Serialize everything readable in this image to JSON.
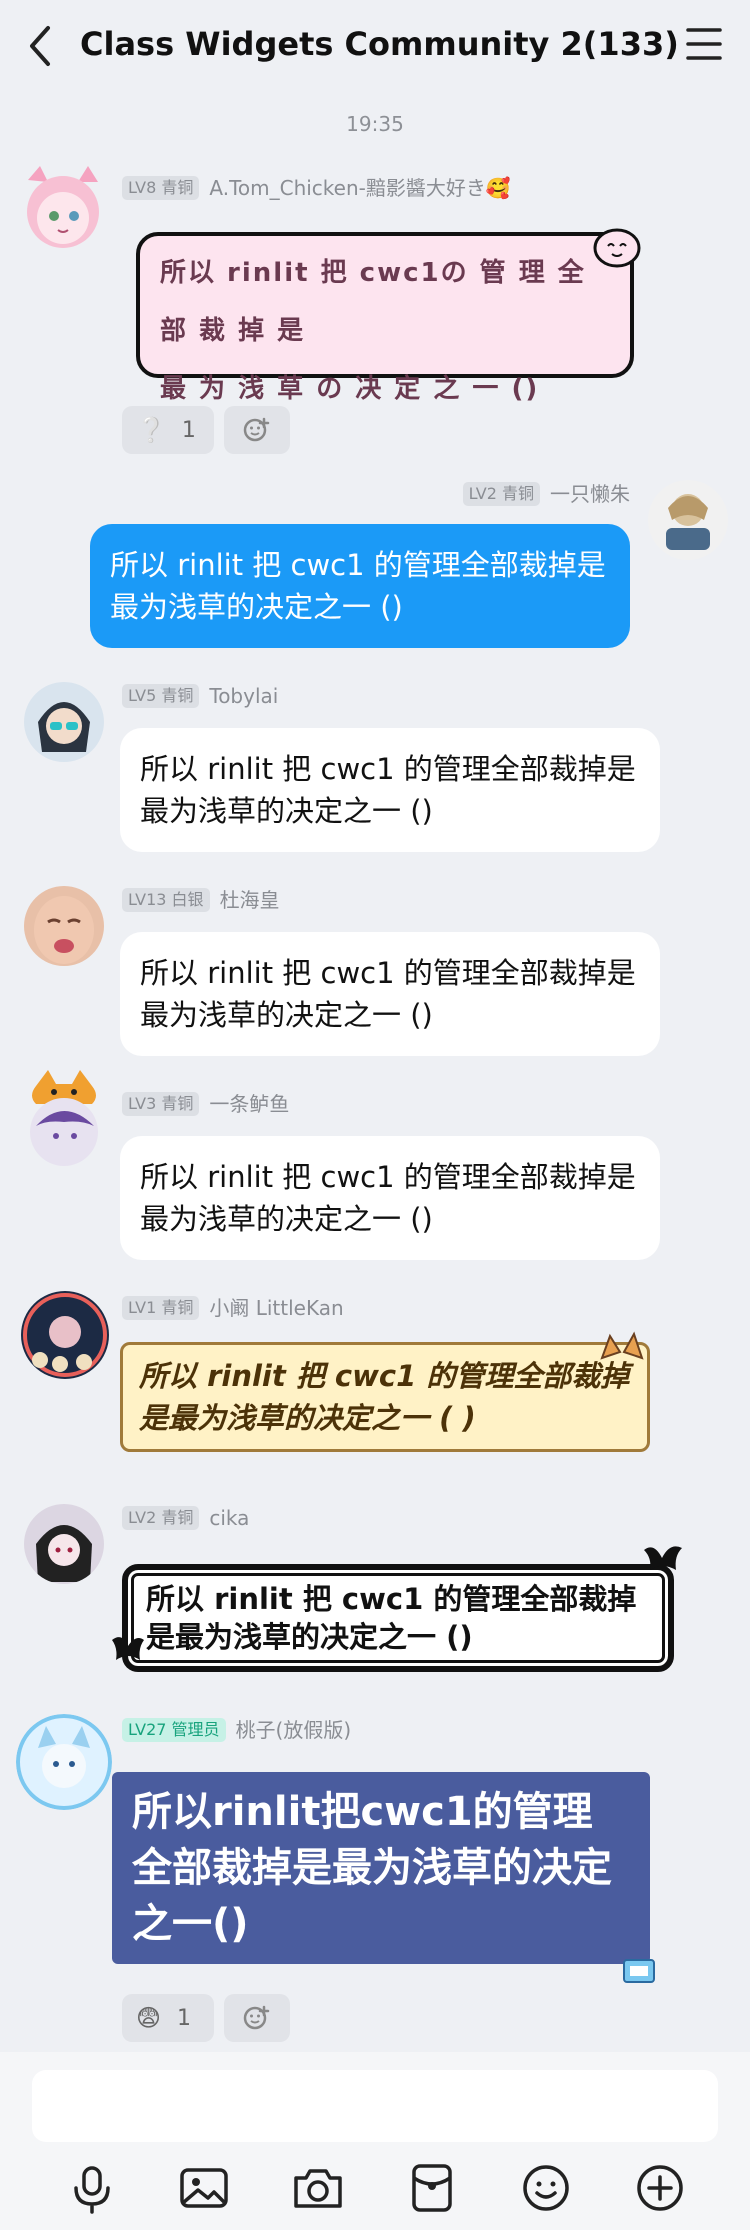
{
  "header": {
    "title": "Class Widgets Community 2(133)"
  },
  "timestamp": "19:35",
  "messages": [
    {
      "badge": "LV8 青铜",
      "name": "A.Tom_Chicken-黯影醬大好き🥰",
      "line1": "所以 rinlit 把 cwc1の 管 理 全 部 裁 掉 是",
      "line2": "最 为 浅 草 の 决 定 之 一 ()"
    },
    {
      "badge": "LV2 青铜",
      "name": "一只懒朱",
      "text": "所以 rinlit 把 cwc1 的管理全部裁掉是最为浅草的决定之一 ()"
    },
    {
      "badge": "LV5 青铜",
      "name": "Tobylai",
      "text": "所以 rinlit 把 cwc1 的管理全部裁掉是最为浅草的决定之一 ()"
    },
    {
      "badge": "LV13 白银",
      "name": "杜海皇",
      "text": "所以 rinlit 把 cwc1 的管理全部裁掉是最为浅草的决定之一 ()"
    },
    {
      "badge": "LV3 青铜",
      "name": "一条鲈鱼",
      "text": "所以 rinlit 把 cwc1 的管理全部裁掉是最为浅草的决定之一 ()"
    },
    {
      "badge": "LV1 青铜",
      "name": "小阚 LittleKan",
      "text": "所以 rinlit 把 cwc1 的管理全部裁掉是最为浅草的决定之一 ( )"
    },
    {
      "badge": "LV2 青铜",
      "name": "cika",
      "text": "所以 rinlit 把 cwc1 的管理全部裁掉是最为浅草的决定之一 ()"
    },
    {
      "badge": "LV27 管理员",
      "name": "桃子(放假版)",
      "text": "所以rinlit把cwc1的管理全部裁掉是最为浅草的决定之一()"
    }
  ],
  "reactions1": [
    {
      "emoji": "❔",
      "count": "1"
    }
  ],
  "reactions2": [
    {
      "emoji": "😨",
      "count": "1"
    }
  ],
  "icons": {
    "back": "chevron-left-icon",
    "menu": "hamburger-menu-icon",
    "add_reaction": "add-reaction-icon",
    "toolbar": [
      "microphone-icon",
      "image-icon",
      "camera-icon",
      "red-packet-icon",
      "emoji-icon",
      "plus-icon"
    ]
  },
  "colors": {
    "accent": "#1b9af7",
    "background": "#eef0f4",
    "admin_badge": "#18a37d"
  }
}
